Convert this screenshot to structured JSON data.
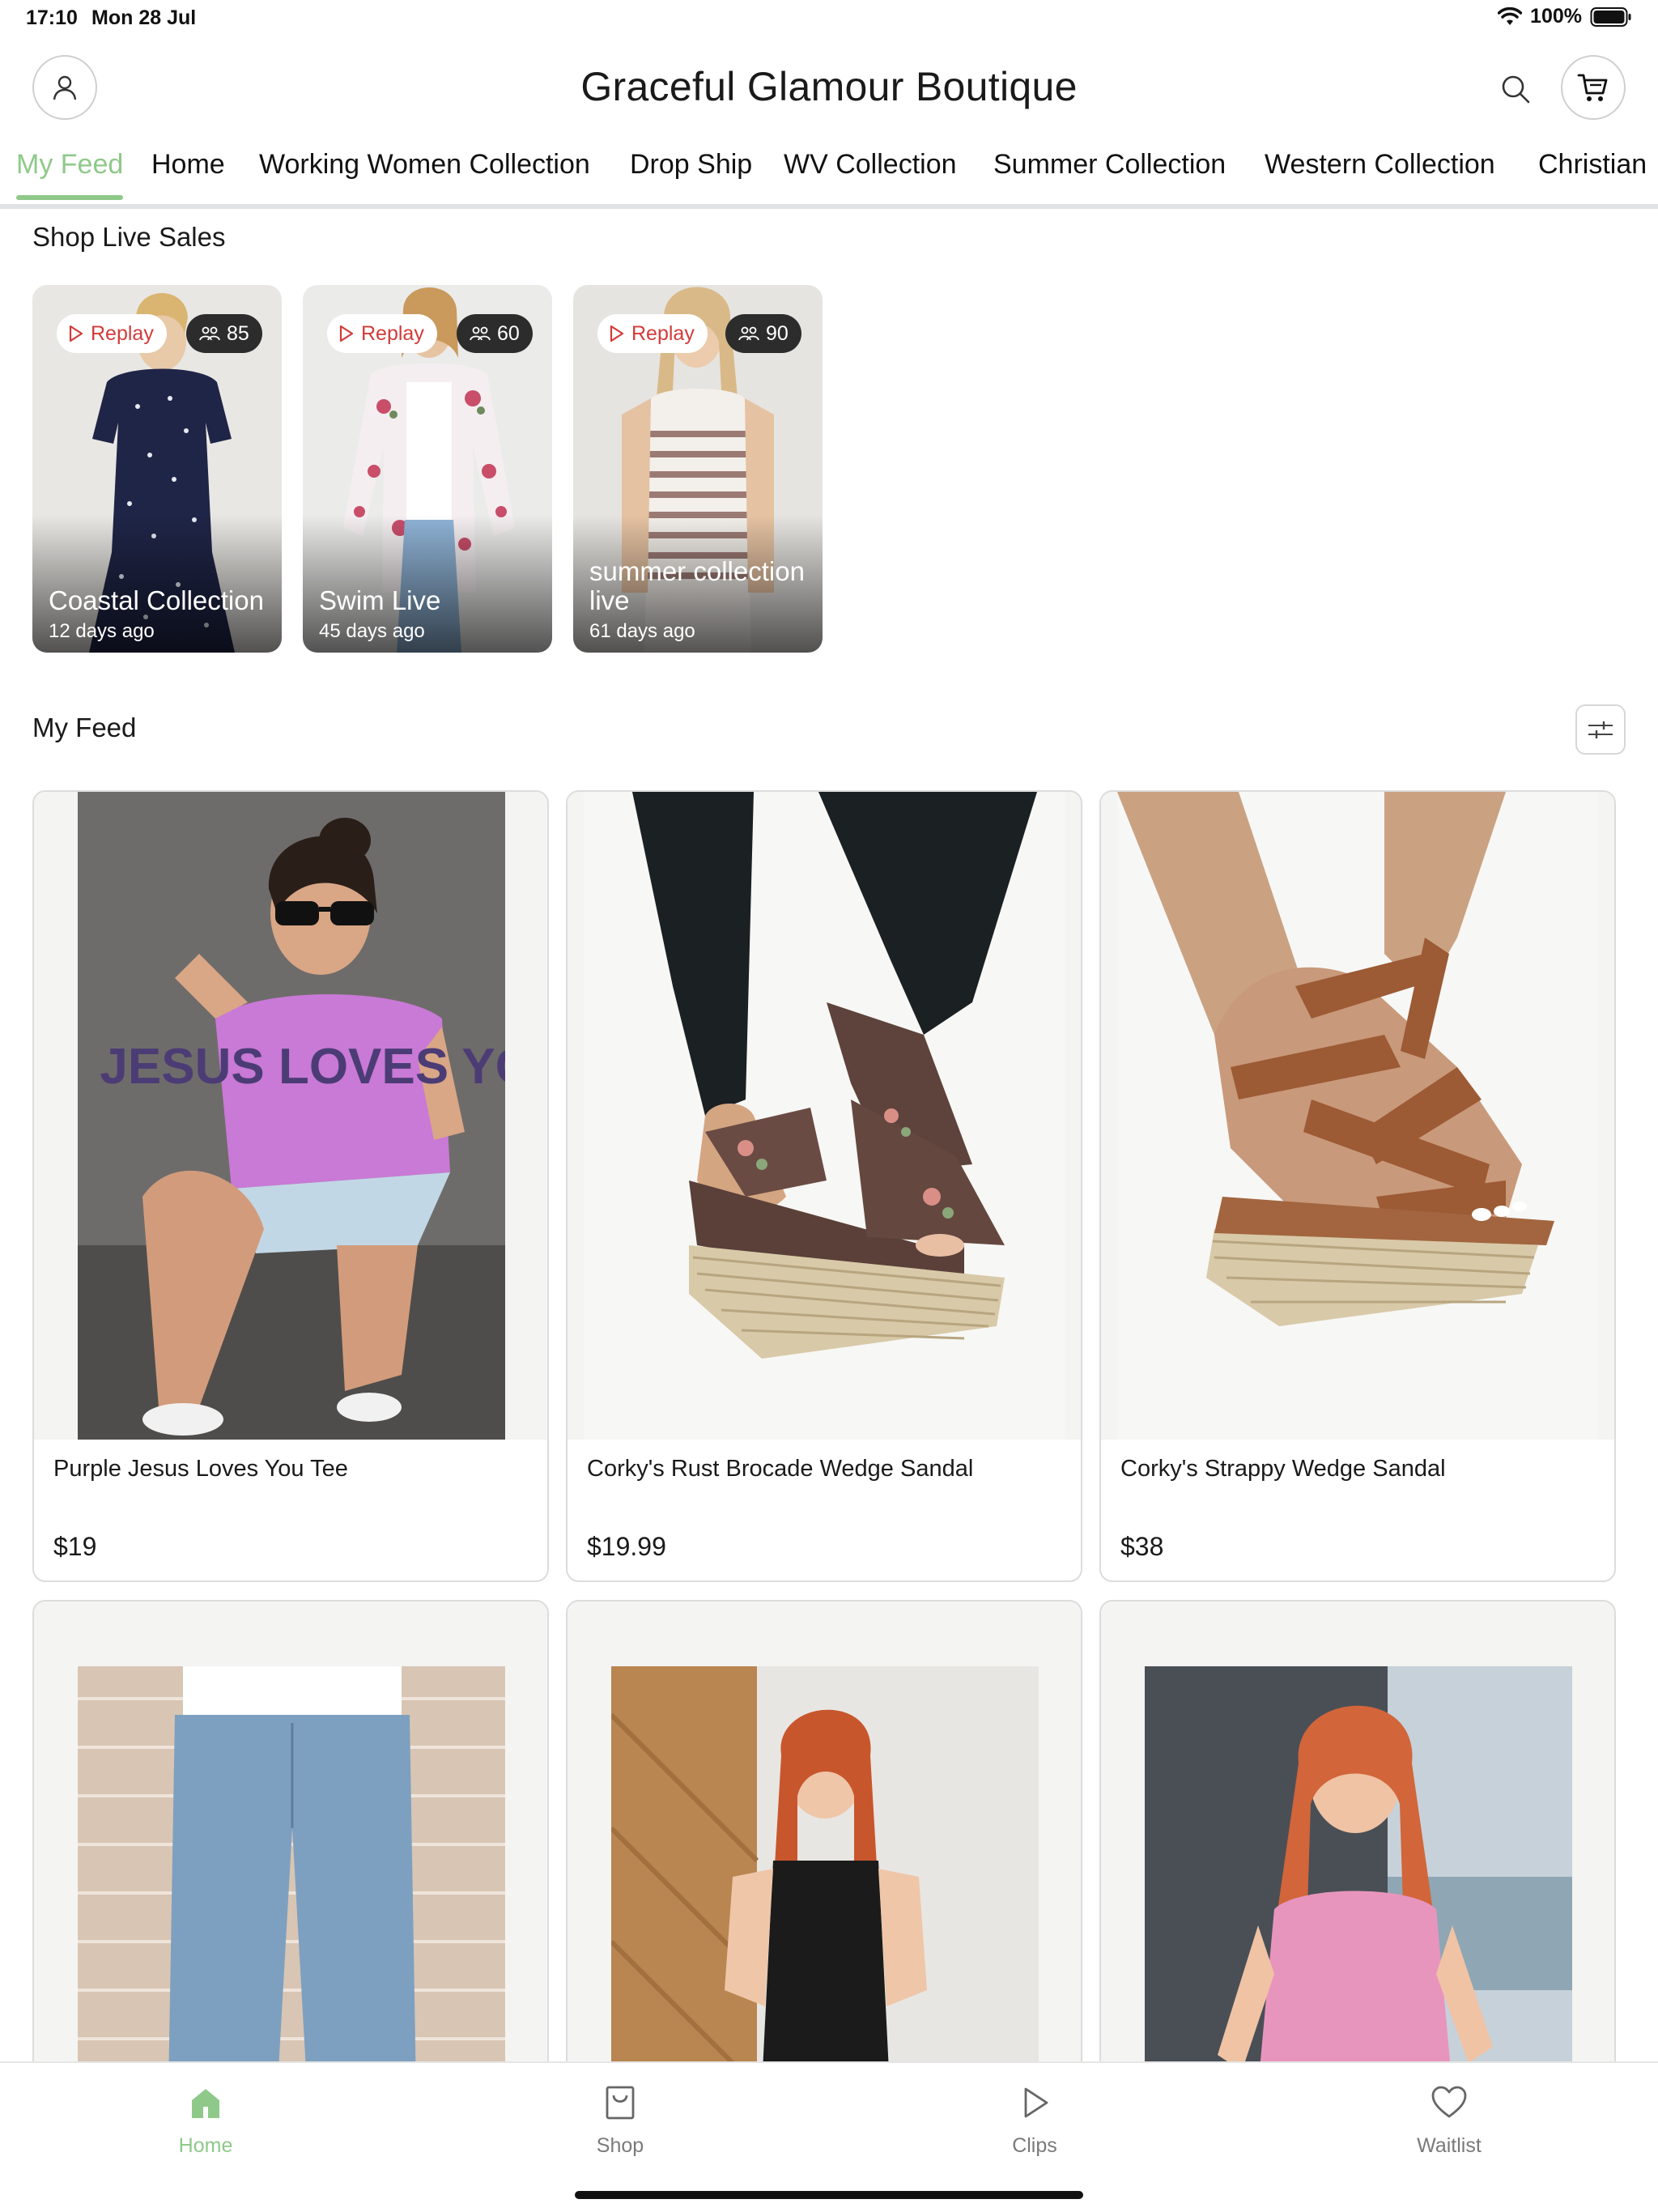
{
  "status_bar": {
    "time": "17:10",
    "date": "Mon 28 Jul",
    "battery": "100%"
  },
  "header": {
    "title": "Graceful Glamour Boutique"
  },
  "tabs": [
    {
      "label": "My Feed",
      "active": true
    },
    {
      "label": "Home"
    },
    {
      "label": "Working Women Collection"
    },
    {
      "label": "Drop Ship"
    },
    {
      "label": "WV Collection"
    },
    {
      "label": "Summer Collection"
    },
    {
      "label": "Western Collection"
    },
    {
      "label": "Christian"
    }
  ],
  "live_sales": {
    "heading": "Shop Live Sales",
    "items": [
      {
        "replay_label": "Replay",
        "viewers": "85",
        "title": "Coastal Collection",
        "ago": "12 days ago"
      },
      {
        "replay_label": "Replay",
        "viewers": "60",
        "title": "Swim Live",
        "ago": "45 days ago"
      },
      {
        "replay_label": "Replay",
        "viewers": "90",
        "title": "summer collection live",
        "ago": "61 days ago"
      }
    ]
  },
  "feed": {
    "heading": "My Feed",
    "products": [
      {
        "name": "Purple Jesus Loves You Tee",
        "price": "$19",
        "shirt_print": "JESUS LOVES YOU"
      },
      {
        "name": "Corky's Rust Brocade Wedge Sandal",
        "price": "$19.99"
      },
      {
        "name": "Corky's Strappy Wedge Sandal",
        "price": "$38"
      },
      {
        "name": "",
        "price": ""
      },
      {
        "name": "",
        "price": ""
      },
      {
        "name": "",
        "price": ""
      }
    ]
  },
  "bottom_nav": [
    {
      "label": "Home",
      "icon": "home-icon",
      "active": true
    },
    {
      "label": "Shop",
      "icon": "shopping-bag-icon"
    },
    {
      "label": "Clips",
      "icon": "play-icon"
    },
    {
      "label": "Waitlist",
      "icon": "heart-icon"
    }
  ],
  "colors": {
    "accent": "#8fc98a",
    "replay": "#d33b3b",
    "divider": "#dfe3e6"
  }
}
